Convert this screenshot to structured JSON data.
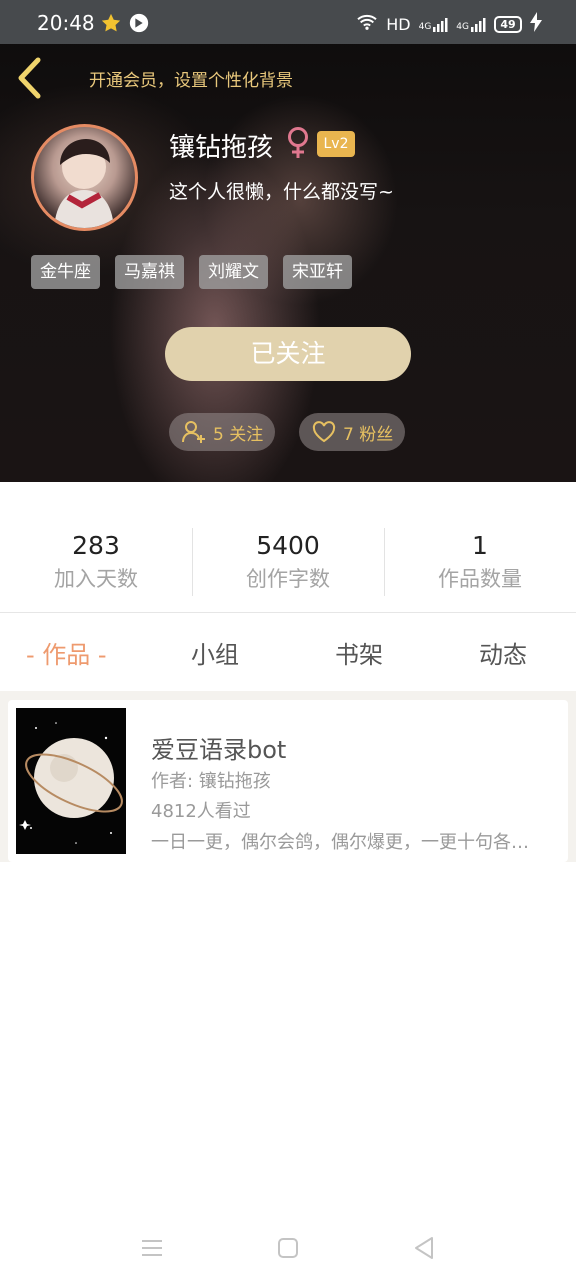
{
  "status_bar": {
    "time": "20:48",
    "network_label": "HD",
    "signal_1": "4G",
    "signal_2": "4G",
    "battery": "49"
  },
  "header": {
    "vip_link": "开通会员，设置个性化背景",
    "username": "镶钻拖孩",
    "gender_icon": "female-icon",
    "level": "Lv2",
    "bio": "这个人很懒，什么都没写~",
    "tags": [
      "金牛座",
      "马嘉祺",
      "刘耀文",
      "宋亚轩"
    ],
    "follow_button": "已关注",
    "following": "5 关注",
    "followers": "7 粉丝"
  },
  "stats": [
    {
      "value": "283",
      "label": "加入天数"
    },
    {
      "value": "5400",
      "label": "创作字数"
    },
    {
      "value": "1",
      "label": "作品数量"
    }
  ],
  "tabs": [
    {
      "label": "- 作品 -",
      "active": true
    },
    {
      "label": "小组",
      "active": false
    },
    {
      "label": "书架",
      "active": false
    },
    {
      "label": "动态",
      "active": false
    }
  ],
  "works": [
    {
      "title": "爱豆语录bot",
      "author": "作者: 镶钻拖孩",
      "views": "4812人看过",
      "description": "一日一更，偶尔会鸽，偶尔爆更，一更十句各…"
    }
  ],
  "colors": {
    "accent_gold": "#e9c87c",
    "tab_active": "#ee9a6e",
    "level_badge": "#e9b54f",
    "follow_button": "#e1d2ad"
  }
}
